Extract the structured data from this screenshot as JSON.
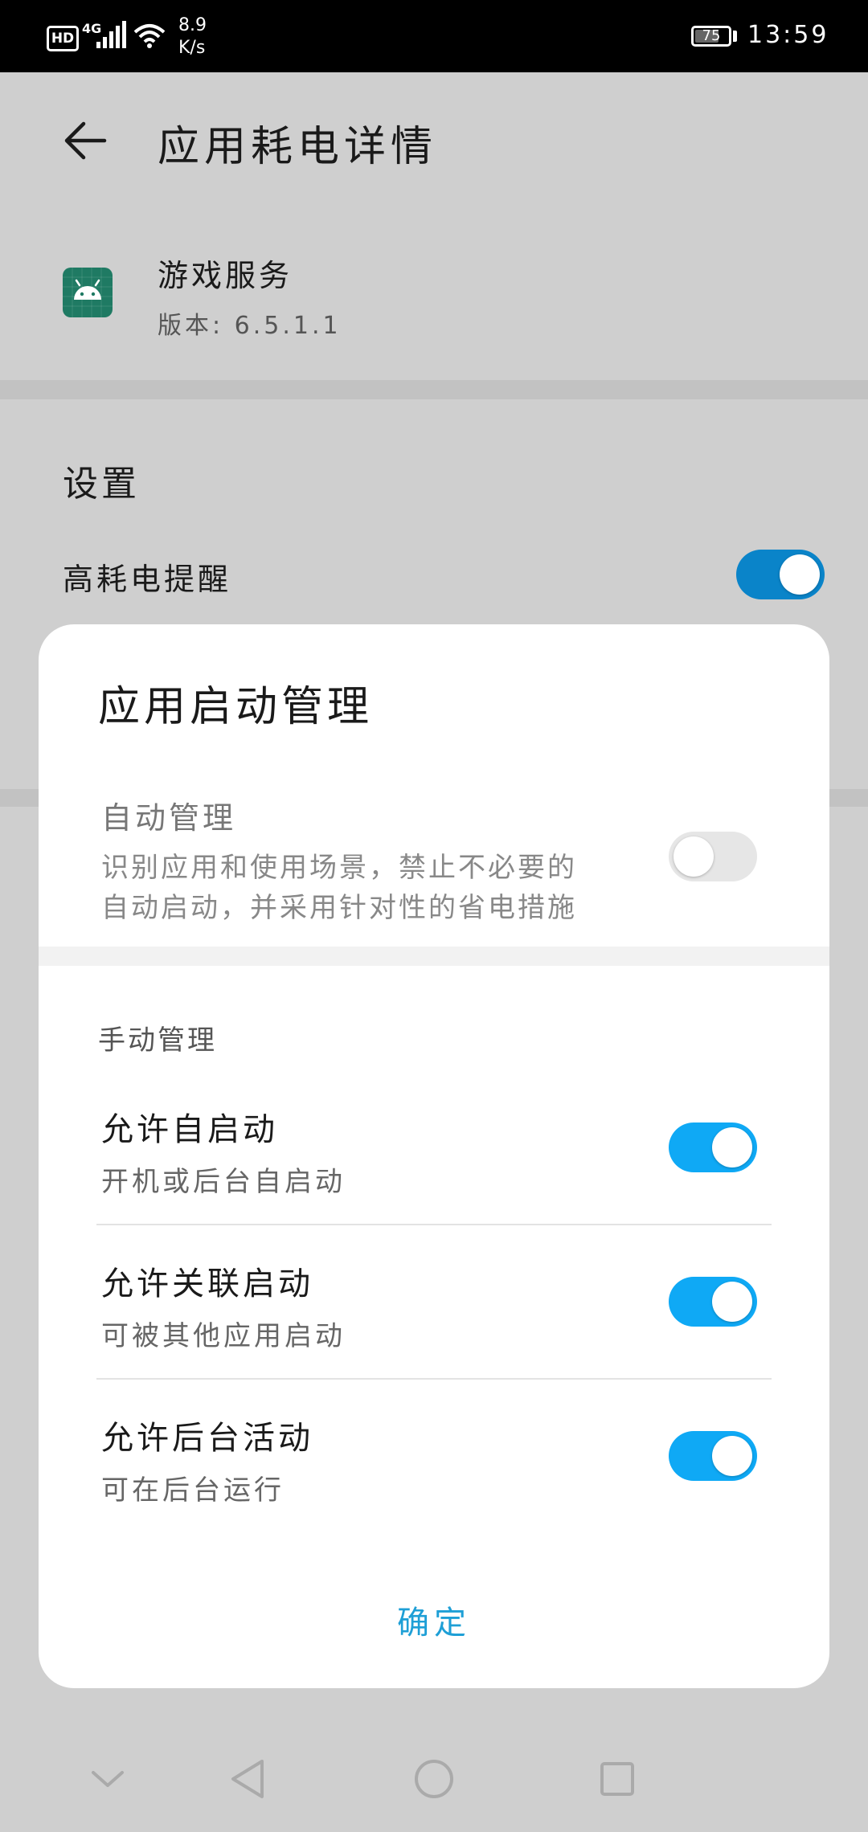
{
  "status_bar": {
    "hd": "HD",
    "network": "4G",
    "speed_value": "8.9",
    "speed_unit": "K/s",
    "battery": "75",
    "battery_level": 0.75,
    "time": "13:59"
  },
  "header": {
    "title": "应用耗电详情"
  },
  "app": {
    "name": "游戏服务",
    "version": "版本: 6.5.1.1"
  },
  "settings": {
    "section_title": "设置",
    "high_drain_reminder": {
      "label": "高耗电提醒",
      "enabled": true
    }
  },
  "dialog": {
    "title": "应用启动管理",
    "auto_management": {
      "label": "自动管理",
      "description_line1": "识别应用和使用场景，禁止不必要的",
      "description_line2": "自动启动，并采用针对性的省电措施",
      "enabled": false
    },
    "manual_header": "手动管理",
    "manual_items": [
      {
        "label": "允许自启动",
        "sub": "开机或后台自启动",
        "enabled": true
      },
      {
        "label": "允许关联启动",
        "sub": "可被其他应用启动",
        "enabled": true
      },
      {
        "label": "允许后台活动",
        "sub": "可在后台运行",
        "enabled": true
      }
    ],
    "confirm_label": "确定"
  },
  "colors": {
    "toggle_on": "#0fa9f5",
    "toggle_on_dimmed": "#0a84c9",
    "toggle_off": "#e6e6e6",
    "confirm_text": "#1e9fd6",
    "scrim": "#cfcfcf"
  }
}
